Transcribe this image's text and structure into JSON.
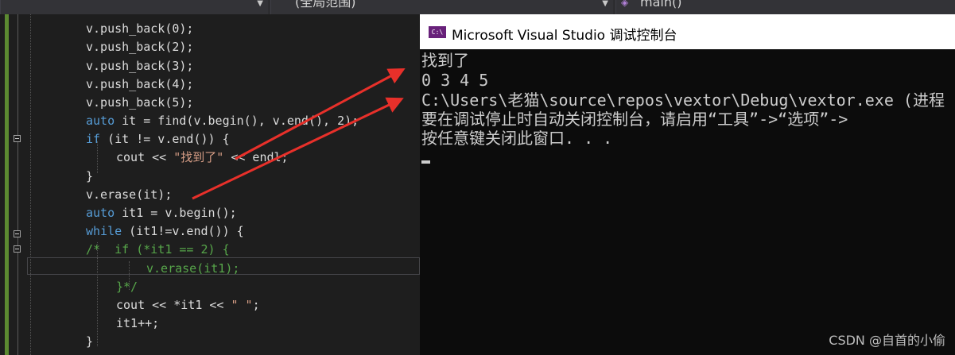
{
  "nav": {
    "scope_label": "(全局范围)",
    "function_label": "main()"
  },
  "editor": {
    "lines": [
      {
        "id": "l1",
        "tokens": [
          {
            "t": "v.push_back(0);",
            "c": ""
          }
        ]
      },
      {
        "id": "l2",
        "tokens": [
          {
            "t": "v.push_back(2);",
            "c": ""
          }
        ]
      },
      {
        "id": "l3",
        "tokens": [
          {
            "t": "v.push_back(3);",
            "c": ""
          }
        ]
      },
      {
        "id": "l4",
        "tokens": [
          {
            "t": "v.push_back(4);",
            "c": ""
          }
        ]
      },
      {
        "id": "l5",
        "tokens": [
          {
            "t": "v.push_back(5);",
            "c": ""
          }
        ]
      },
      {
        "id": "l6",
        "tokens": [
          {
            "t": "auto",
            "c": "kw"
          },
          {
            "t": " it = find(v.begin(), v.end(), 2);",
            "c": ""
          }
        ]
      },
      {
        "id": "l7",
        "tokens": [
          {
            "t": "if",
            "c": "kw"
          },
          {
            "t": " (it != v.end()) {",
            "c": ""
          }
        ]
      },
      {
        "id": "l8",
        "tokens": [
          {
            "t": "cout << ",
            "c": ""
          },
          {
            "t": "\"找到了\"",
            "c": "str"
          },
          {
            "t": " << endl;",
            "c": ""
          }
        ]
      },
      {
        "id": "l9",
        "tokens": [
          {
            "t": "}",
            "c": ""
          }
        ]
      },
      {
        "id": "l10",
        "tokens": [
          {
            "t": "v.erase(it);",
            "c": ""
          }
        ]
      },
      {
        "id": "l11",
        "tokens": [
          {
            "t": "auto",
            "c": "kw"
          },
          {
            "t": " it1 = v.begin();",
            "c": ""
          }
        ]
      },
      {
        "id": "l12",
        "tokens": [
          {
            "t": "while",
            "c": "kw"
          },
          {
            "t": " (it1!=v.end()) {",
            "c": ""
          }
        ]
      },
      {
        "id": "l13",
        "tokens": [
          {
            "t": "/*  if (*it1 == 2) {",
            "c": "cmt"
          }
        ]
      },
      {
        "id": "l14",
        "tokens": [
          {
            "t": "v.erase(it1);",
            "c": "cmt"
          }
        ]
      },
      {
        "id": "l15",
        "tokens": [
          {
            "t": "}*/",
            "c": "cmt"
          }
        ]
      },
      {
        "id": "l16",
        "tokens": [
          {
            "t": "cout << *it1 << ",
            "c": ""
          },
          {
            "t": "\" \"",
            "c": "str"
          },
          {
            "t": ";",
            "c": ""
          }
        ]
      },
      {
        "id": "l17",
        "tokens": [
          {
            "t": "it1++;",
            "c": ""
          }
        ]
      },
      {
        "id": "l18",
        "tokens": [
          {
            "t": "}",
            "c": ""
          }
        ]
      }
    ]
  },
  "console": {
    "icon_text": "C:\\",
    "title": "Microsoft Visual Studio 调试控制台",
    "output_lines": [
      "找到了",
      "0 3 4 5",
      "C:\\Users\\老猫\\source\\repos\\vextor\\Debug\\vextor.exe (进程",
      "要在调试停止时自动关闭控制台，请启用“工具”->“选项”->",
      "按任意键关闭此窗口. . ."
    ]
  },
  "watermark": "CSDN @自首的小偷",
  "colors": {
    "keyword": "#569cd6",
    "string": "#d69d85",
    "comment": "#57a64a",
    "arrow": "#e8302a"
  }
}
